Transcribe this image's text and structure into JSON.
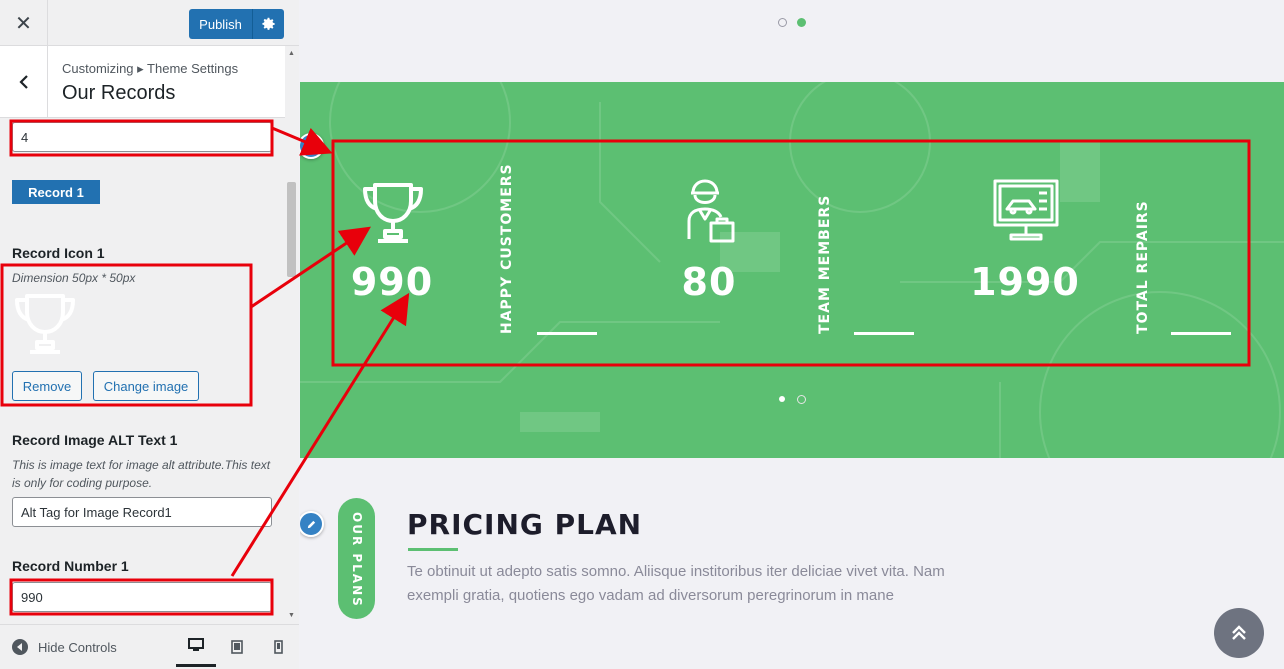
{
  "header": {
    "close_icon": "close-icon",
    "publish_label": "Publish",
    "settings_icon": "gear-icon"
  },
  "section": {
    "breadcrumb": "Customizing ▸ Theme Settings",
    "title": "Our Records"
  },
  "fields": {
    "count_value": "4",
    "record_tag": "Record 1",
    "icon_label": "Record Icon 1",
    "icon_desc": "Dimension 50px * 50px",
    "remove_label": "Remove",
    "change_image_label": "Change image",
    "alt_label": "Record Image ALT Text 1",
    "alt_desc": "This is image text for image alt attribute.This text is only for coding purpose.",
    "alt_value": "Alt Tag for Image Record1",
    "number_label": "Record Number 1",
    "number_value": "990"
  },
  "footer": {
    "hide_controls_label": "Hide Controls",
    "devices": [
      "desktop",
      "tablet",
      "mobile"
    ]
  },
  "preview": {
    "stats": [
      {
        "number": "990",
        "label": "HAPPY CUSTOMERS",
        "icon": "trophy-icon"
      },
      {
        "number": "80",
        "label": "TEAM MEMBERS",
        "icon": "technician-icon"
      },
      {
        "number": "1990",
        "label": "TOTAL REPAIRS",
        "icon": "monitor-repair-icon"
      }
    ],
    "pricing": {
      "badge": "OUR PLANS",
      "title": "PRICING PLAN",
      "text": "Te obtinuit ut adepto satis somno. Aliisque institoribus iter deliciae vivet vita. Nam exempli gratia, quotiens ego vadam ad diversorum peregrinorum in mane"
    }
  },
  "colors": {
    "accent_green": "#5cbf72",
    "wp_blue": "#2271b1",
    "annotation_red": "#e8000b"
  }
}
